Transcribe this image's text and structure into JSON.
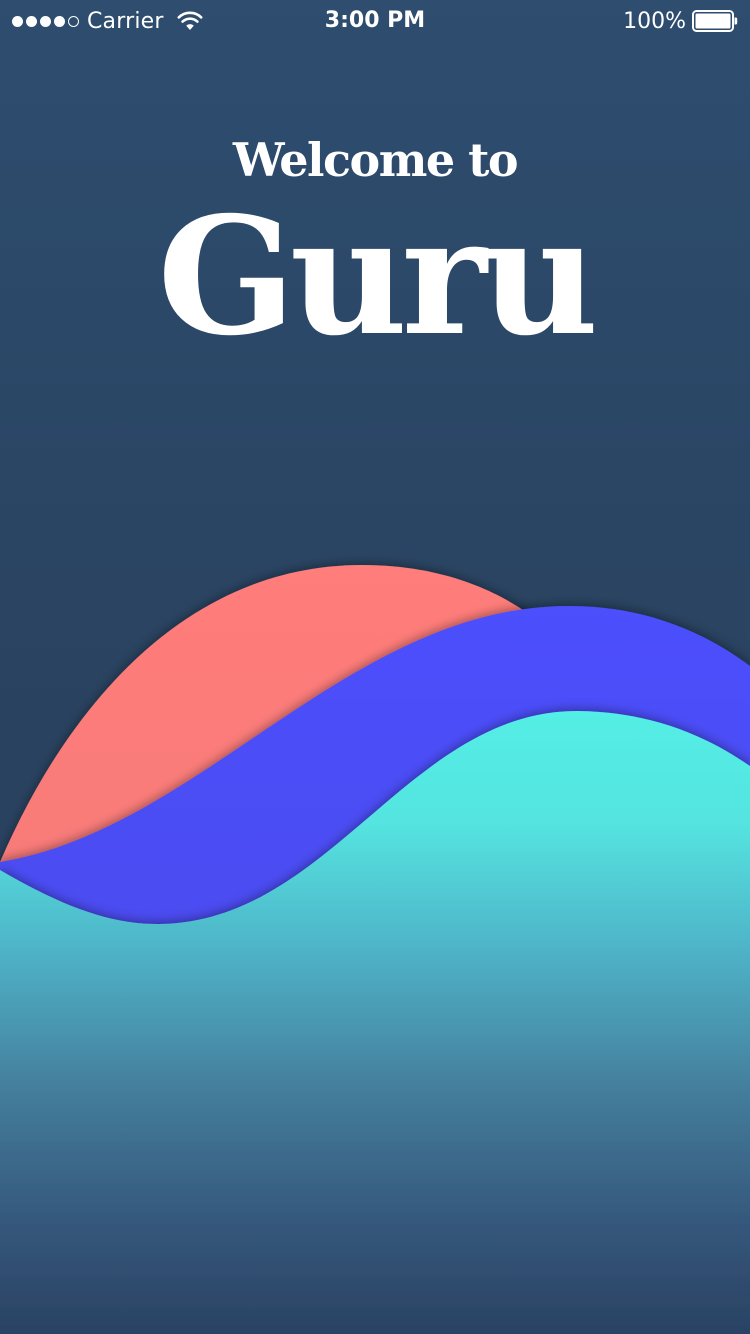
{
  "status_bar": {
    "carrier": "Carrier",
    "time": "3:00 PM",
    "battery_percent": "100%",
    "signal_bars_filled": 4,
    "signal_bars_total": 5
  },
  "welcome": {
    "line1": "Welcome to",
    "app_name": "Guru"
  },
  "colors": {
    "background": "#2b4566",
    "coral_wave": "#ff7d7a",
    "indigo_wave": "#4b4ffc",
    "teal_wave": "#53eee5"
  },
  "icons": {
    "wifi": "wifi-icon",
    "battery": "battery-icon"
  }
}
